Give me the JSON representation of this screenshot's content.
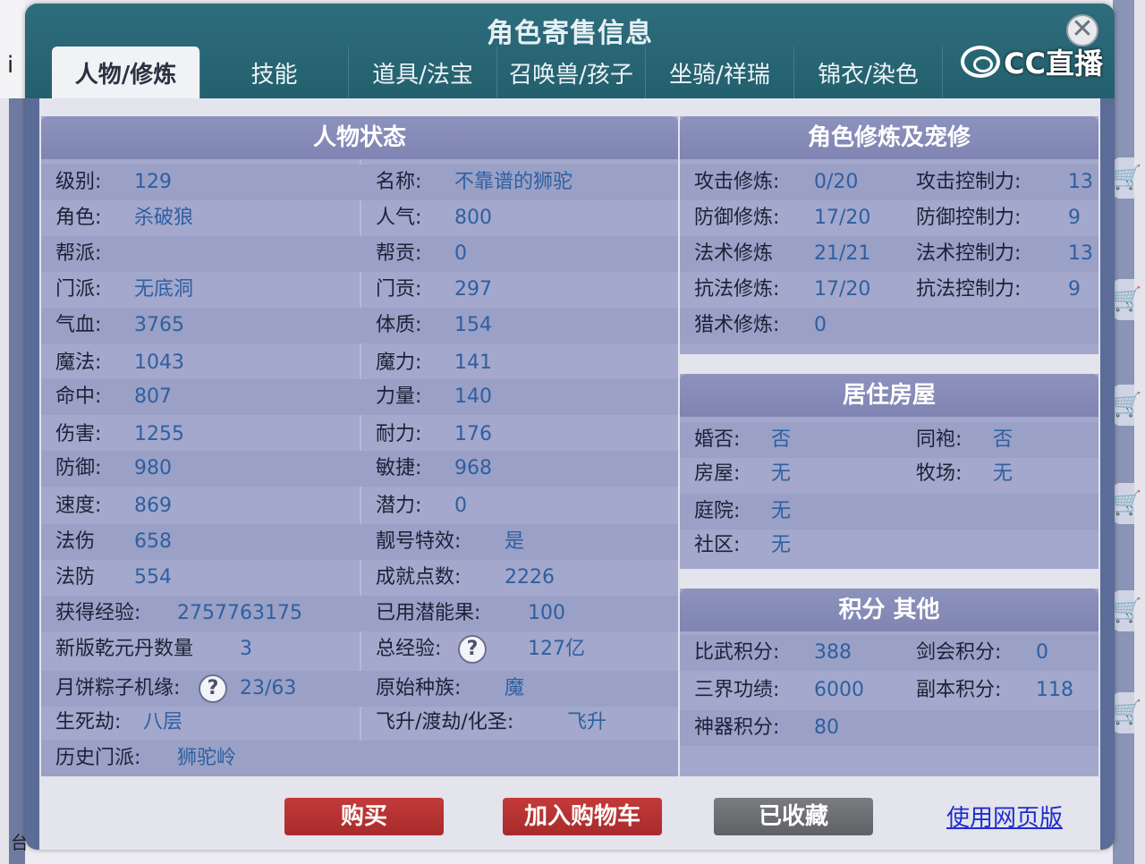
{
  "dialog": {
    "title": "角色寄售信息",
    "close_symbol": "✕",
    "watermark": "CC直播"
  },
  "background": {
    "left_fragment": "i",
    "bottom_fragment": "台"
  },
  "tabs": [
    {
      "label": "人物/修炼",
      "active": true
    },
    {
      "label": "技能"
    },
    {
      "label": "道具/法宝"
    },
    {
      "label": "召唤兽/孩子"
    },
    {
      "label": "坐骑/祥瑞"
    },
    {
      "label": "锦衣/染色"
    }
  ],
  "status": {
    "header": "人物状态",
    "left": [
      {
        "label": "级别:",
        "value": "129"
      },
      {
        "label": "角色:",
        "value": "杀破狼"
      },
      {
        "label": "帮派:",
        "value": ""
      },
      {
        "label": "门派:",
        "value": "无底洞"
      },
      {
        "label": "气血:",
        "value": "3765"
      },
      {
        "label": "魔法:",
        "value": "1043"
      },
      {
        "label": "命中:",
        "value": "807"
      },
      {
        "label": "伤害:",
        "value": "1255"
      },
      {
        "label": "防御:",
        "value": "980"
      },
      {
        "label": "速度:",
        "value": "869"
      },
      {
        "label": "法伤",
        "value": "658"
      },
      {
        "label": "法防",
        "value": "554"
      },
      {
        "label": "获得经验:",
        "value": "2757763175"
      },
      {
        "label": "新版乾元丹数量",
        "value": "3"
      },
      {
        "label": "月饼粽子机缘:",
        "value": "23/63"
      },
      {
        "label": "生死劫:",
        "value": "八层"
      },
      {
        "label": "历史门派:",
        "value": "狮驼岭"
      }
    ],
    "right": [
      {
        "label": "名称:",
        "value": "不靠谱的狮驼"
      },
      {
        "label": "人气:",
        "value": "800"
      },
      {
        "label": "帮贡:",
        "value": "0"
      },
      {
        "label": "门贡:",
        "value": "297"
      },
      {
        "label": "体质:",
        "value": "154"
      },
      {
        "label": "魔力:",
        "value": "141"
      },
      {
        "label": "力量:",
        "value": "140"
      },
      {
        "label": "耐力:",
        "value": "176"
      },
      {
        "label": "敏捷:",
        "value": "968"
      },
      {
        "label": "潜力:",
        "value": "0"
      },
      {
        "label": "靓号特效:",
        "value": "是"
      },
      {
        "label": "成就点数:",
        "value": "2226"
      },
      {
        "label": "已用潜能果:",
        "value": "100"
      },
      {
        "label": "总经验:",
        "value": "127亿"
      },
      {
        "label": "原始种族:",
        "value": "魔"
      },
      {
        "label": "飞升/渡劫/化圣:",
        "value": "飞升"
      }
    ],
    "help_symbol": "?"
  },
  "cultivation": {
    "header": "角色修炼及宠修",
    "rows": [
      {
        "label": "攻击修炼:",
        "value": "0/20",
        "label2": "攻击控制力:",
        "value2": "13"
      },
      {
        "label": "防御修炼:",
        "value": "17/20",
        "label2": "防御控制力:",
        "value2": "9"
      },
      {
        "label": "法术修炼",
        "value": "21/21",
        "label2": "法术控制力:",
        "value2": "13"
      },
      {
        "label": "抗法修炼:",
        "value": "17/20",
        "label2": "抗法控制力:",
        "value2": "9"
      },
      {
        "label": "猎术修炼:",
        "value": "0",
        "label2": "",
        "value2": ""
      }
    ]
  },
  "housing": {
    "header": "居住房屋",
    "rows": [
      {
        "label": "婚否:",
        "value": "否",
        "label2": "同袍:",
        "value2": "否"
      },
      {
        "label": "房屋:",
        "value": "无",
        "label2": "牧场:",
        "value2": "无"
      },
      {
        "label": "庭院:",
        "value": "无",
        "label2": "",
        "value2": ""
      },
      {
        "label": "社区:",
        "value": "无",
        "label2": "",
        "value2": ""
      }
    ]
  },
  "points": {
    "header": "积分 其他",
    "rows": [
      {
        "label": "比武积分:",
        "value": "388",
        "label2": "剑会积分:",
        "value2": "0"
      },
      {
        "label": "三界功绩:",
        "value": "6000",
        "label2": "副本积分:",
        "value2": "118"
      },
      {
        "label": "神器积分:",
        "value": "80",
        "label2": "",
        "value2": ""
      }
    ]
  },
  "actions": {
    "buy": "购买",
    "add_cart": "加入购物车",
    "favorited": "已收藏",
    "web_version": "使用网页版"
  }
}
